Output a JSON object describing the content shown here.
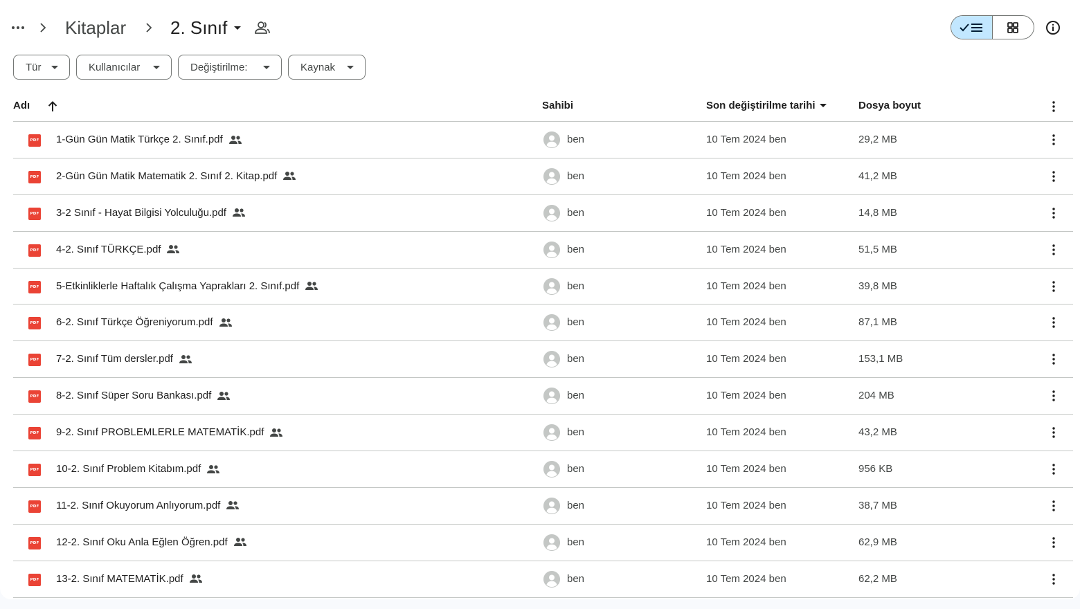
{
  "breadcrumb": {
    "parent": "Kitaplar",
    "current": "2. Sınıf",
    "more_icon": "more-horiz-icon",
    "separator_icon": "chevron-right-icon",
    "share_icon": "shared-folder-icon"
  },
  "view_toggle": {
    "selected": "list",
    "list_icon": "check-list-icon",
    "grid_icon": "grid-view-icon"
  },
  "info_icon": "info-icon",
  "filters": [
    {
      "label": "Tür"
    },
    {
      "label": "Kullanıcılar"
    },
    {
      "label": "Değiştirilme:"
    },
    {
      "label": "Kaynak"
    }
  ],
  "columns": {
    "name": "Adı",
    "owner": "Sahibi",
    "modified": "Son değiştirilme tarihi",
    "size": "Dosya boyut"
  },
  "colors": {
    "accent": "#c2e7ff",
    "pdf_red": "#ea4335",
    "border": "#c4c7c5"
  },
  "files": [
    {
      "name": "1-Gün Gün Matik Türkçe 2. Sınıf.pdf",
      "owner": "ben",
      "modified": "10 Tem 2024",
      "modified_by": "ben",
      "size": "29,2 MB"
    },
    {
      "name": "2-Gün Gün Matik Matematik 2. Sınıf 2. Kitap.pdf",
      "owner": "ben",
      "modified": "10 Tem 2024",
      "modified_by": "ben",
      "size": "41,2 MB"
    },
    {
      "name": "3-2 Sınıf - Hayat Bilgisi Yolculuğu.pdf",
      "owner": "ben",
      "modified": "10 Tem 2024",
      "modified_by": "ben",
      "size": "14,8 MB"
    },
    {
      "name": "4-2. Sınıf TÜRKÇE.pdf",
      "owner": "ben",
      "modified": "10 Tem 2024",
      "modified_by": "ben",
      "size": "51,5 MB"
    },
    {
      "name": "5-Etkinliklerle Haftalık Çalışma Yaprakları 2. Sınıf.pdf",
      "owner": "ben",
      "modified": "10 Tem 2024",
      "modified_by": "ben",
      "size": "39,8 MB"
    },
    {
      "name": "6-2. Sınıf Türkçe Öğreniyorum.pdf",
      "owner": "ben",
      "modified": "10 Tem 2024",
      "modified_by": "ben",
      "size": "87,1 MB"
    },
    {
      "name": "7-2. Sınıf Tüm dersler.pdf",
      "owner": "ben",
      "modified": "10 Tem 2024",
      "modified_by": "ben",
      "size": "153,1 MB"
    },
    {
      "name": "8-2. Sınıf Süper Soru Bankası.pdf",
      "owner": "ben",
      "modified": "10 Tem 2024",
      "modified_by": "ben",
      "size": "204 MB"
    },
    {
      "name": "9-2. Sınıf PROBLEMLERLE MATEMATİK.pdf",
      "owner": "ben",
      "modified": "10 Tem 2024",
      "modified_by": "ben",
      "size": "43,2 MB"
    },
    {
      "name": "10-2. Sınıf Problem Kitabım.pdf",
      "owner": "ben",
      "modified": "10 Tem 2024",
      "modified_by": "ben",
      "size": "956 KB"
    },
    {
      "name": "11-2. Sınıf Okuyorum Anlıyorum.pdf",
      "owner": "ben",
      "modified": "10 Tem 2024",
      "modified_by": "ben",
      "size": "38,7 MB"
    },
    {
      "name": "12-2. Sınıf Oku Anla Eğlen Öğren.pdf",
      "owner": "ben",
      "modified": "10 Tem 2024",
      "modified_by": "ben",
      "size": "62,9 MB"
    },
    {
      "name": "13-2. Sınıf MATEMATİK.pdf",
      "owner": "ben",
      "modified": "10 Tem 2024",
      "modified_by": "ben",
      "size": "62,2 MB"
    }
  ]
}
